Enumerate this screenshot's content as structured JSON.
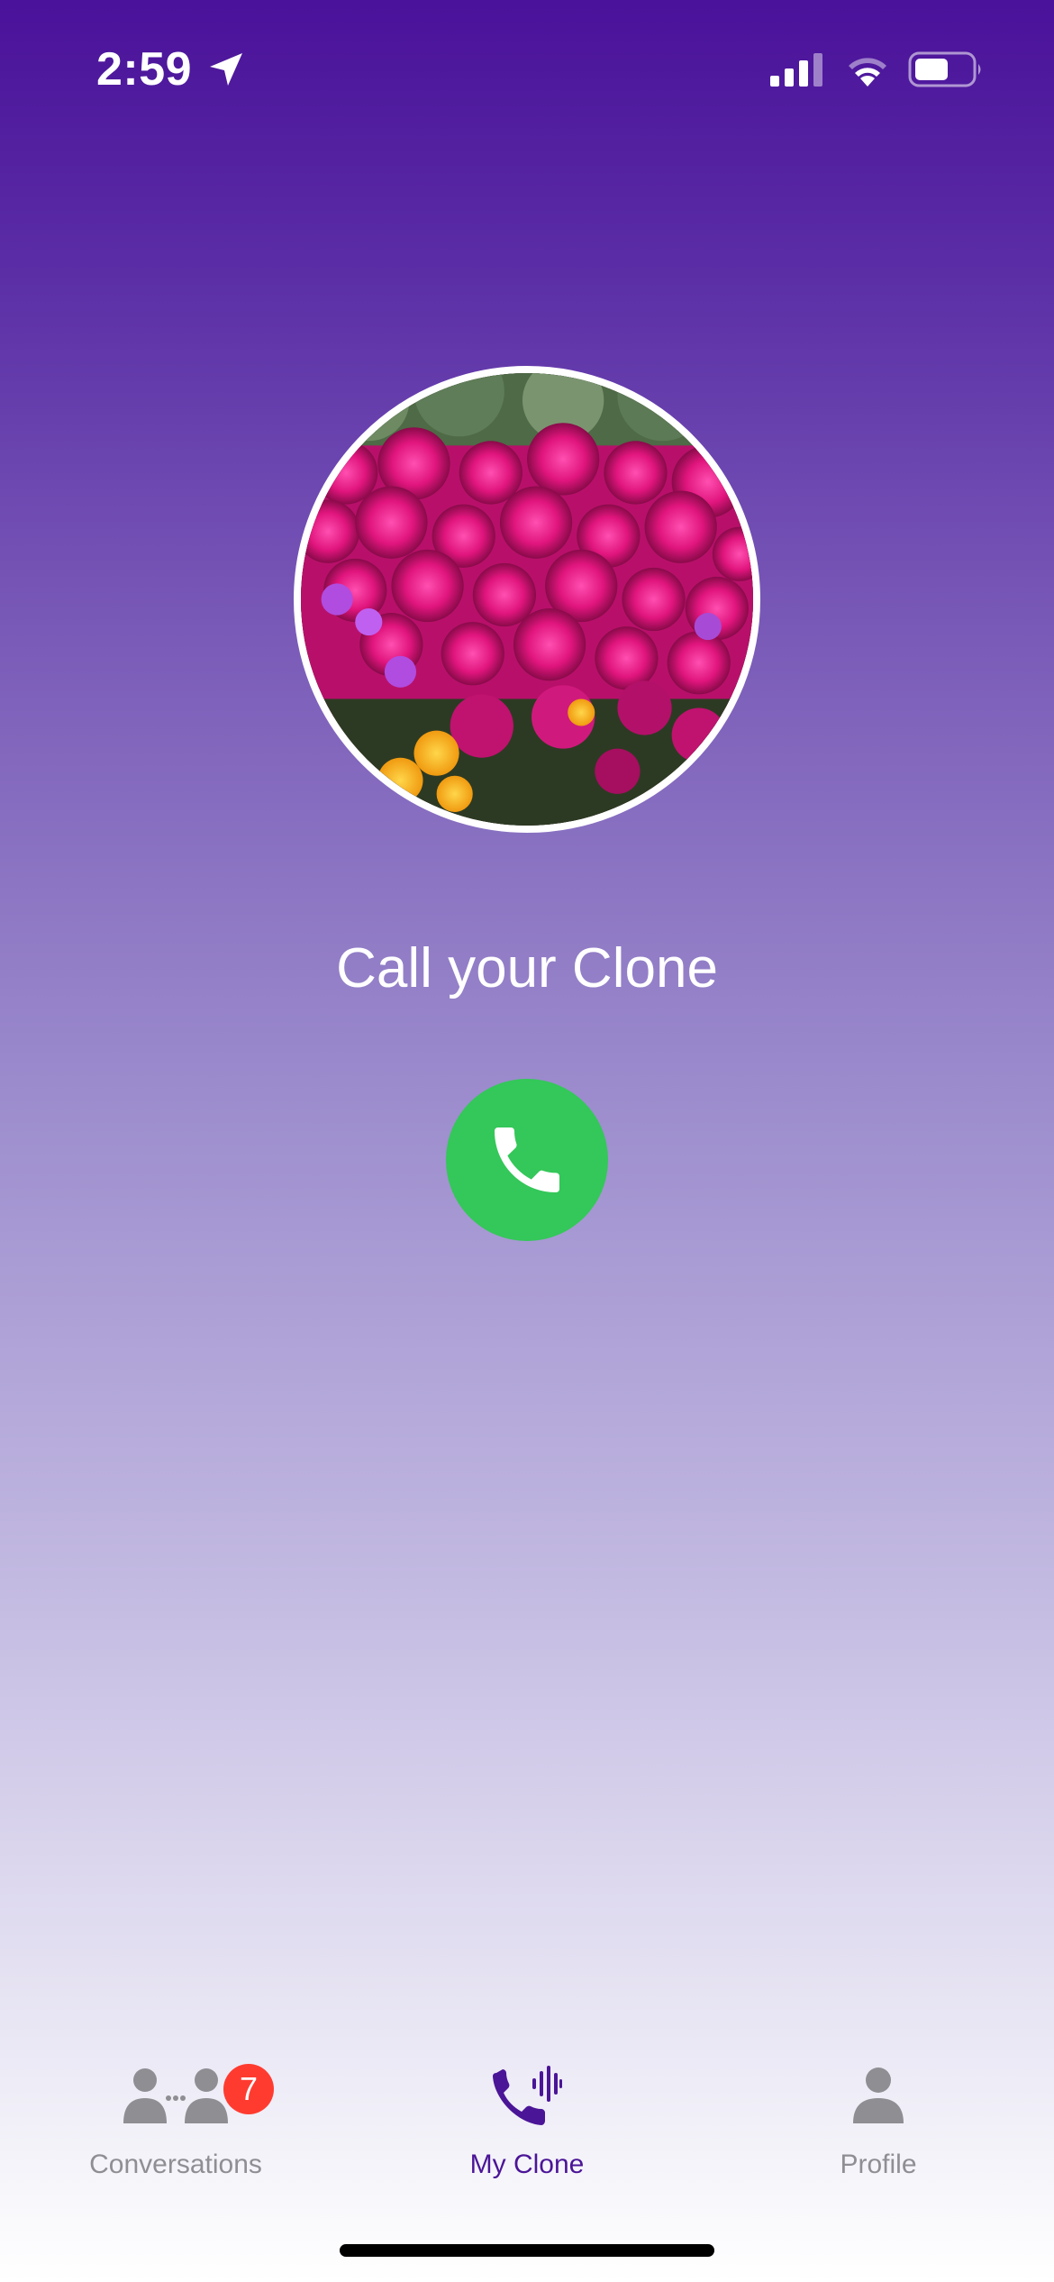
{
  "status_bar": {
    "time": "2:59",
    "icons": [
      "location-arrow-icon",
      "cellular-signal-icon",
      "wifi-icon",
      "battery-icon"
    ]
  },
  "main": {
    "avatar_image": "flower-field-photo",
    "title": "Call your Clone",
    "call_button_icon": "phone-icon",
    "call_button_color": "#34c759"
  },
  "tab_bar": {
    "tabs": [
      {
        "label": "Conversations",
        "icon": "people-icon",
        "badge": "7",
        "active": false
      },
      {
        "label": "My Clone",
        "icon": "phone-waveform-icon",
        "active": true
      },
      {
        "label": "Profile",
        "icon": "person-icon",
        "active": false
      }
    ],
    "active_color": "#4b1597",
    "inactive_color": "#8e8e93",
    "badge_color": "#ff3b30"
  },
  "colors": {
    "gradient_top": "#4a119a",
    "gradient_bottom": "#ffffff"
  }
}
